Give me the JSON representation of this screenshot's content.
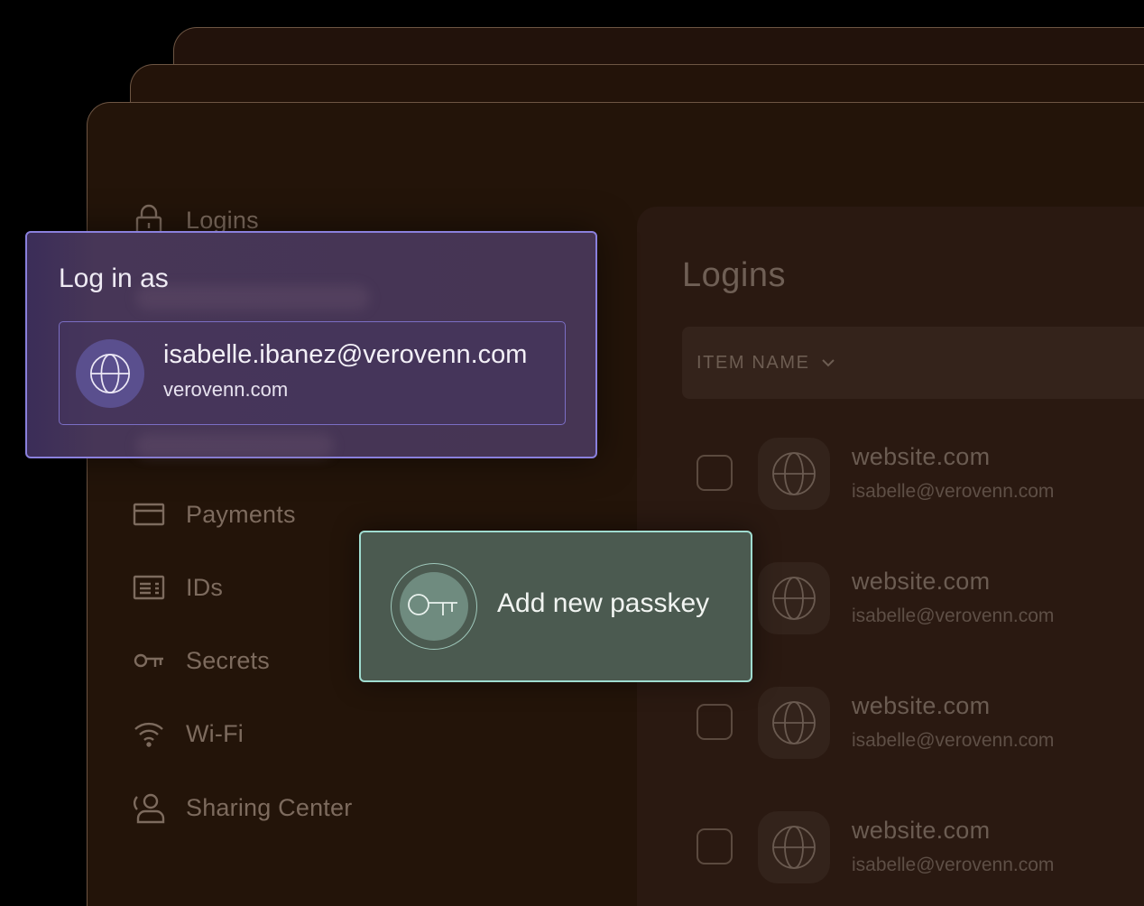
{
  "nav": {
    "logins": "Logins",
    "payments": "Payments",
    "ids": "IDs",
    "secrets": "Secrets",
    "wifi": "Wi-Fi",
    "sharing": "Sharing Center"
  },
  "panel": {
    "title": "Logins",
    "column_header": "ITEM NAME",
    "rows": [
      {
        "site": "website.com",
        "user": "isabelle@verovenn.com"
      },
      {
        "site": "website.com",
        "user": "isabelle@verovenn.com"
      },
      {
        "site": "website.com",
        "user": "isabelle@verovenn.com"
      },
      {
        "site": "website.com",
        "user": "isabelle@verovenn.com"
      }
    ]
  },
  "login_popup": {
    "title": "Log in as",
    "email": "isabelle.ibanez@verovenn.com",
    "domain": "verovenn.com"
  },
  "passkey": {
    "label": "Add new passkey"
  },
  "icons": {
    "logins": "lock-icon",
    "payments": "card-icon",
    "ids": "id-card-icon",
    "secrets": "key-icon",
    "wifi": "wifi-icon",
    "sharing": "sharing-icon",
    "account": "globe-icon",
    "passkey": "key-icon",
    "sort": "chevron-down-icon"
  },
  "colors": {
    "window_bg": "#231409",
    "login_popup_border": "#8a80dd",
    "passkey_border": "#9fdcd0"
  }
}
